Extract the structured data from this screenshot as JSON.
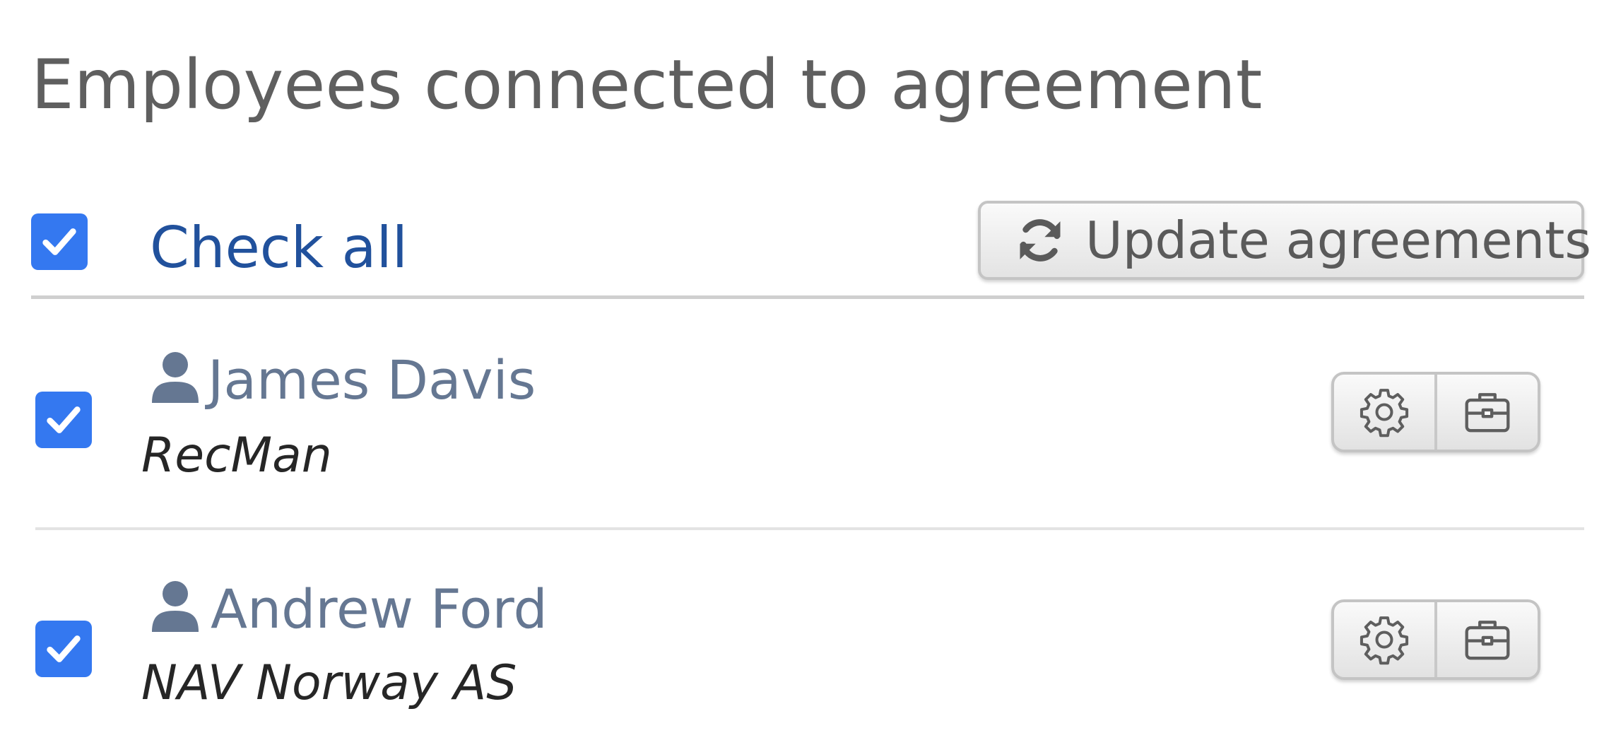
{
  "page": {
    "title": "Employees connected to agreement"
  },
  "toolbar": {
    "check_all": {
      "label": "Check all",
      "checked": true
    },
    "update_button": {
      "label": "Update agreements",
      "icon": "refresh-icon"
    }
  },
  "employees": [
    {
      "name": "James Davis",
      "company": "RecMan",
      "checked": true,
      "icons": [
        "user-icon",
        "gear-icon",
        "briefcase-icon"
      ]
    },
    {
      "name": "Andrew Ford",
      "company": "NAV Norway AS",
      "checked": true,
      "icons": [
        "user-icon",
        "gear-icon",
        "briefcase-icon"
      ]
    }
  ],
  "colors": {
    "checkbox": "#3478f0",
    "link": "#21519c",
    "name": "#657792",
    "title": "#5f5f5f"
  }
}
